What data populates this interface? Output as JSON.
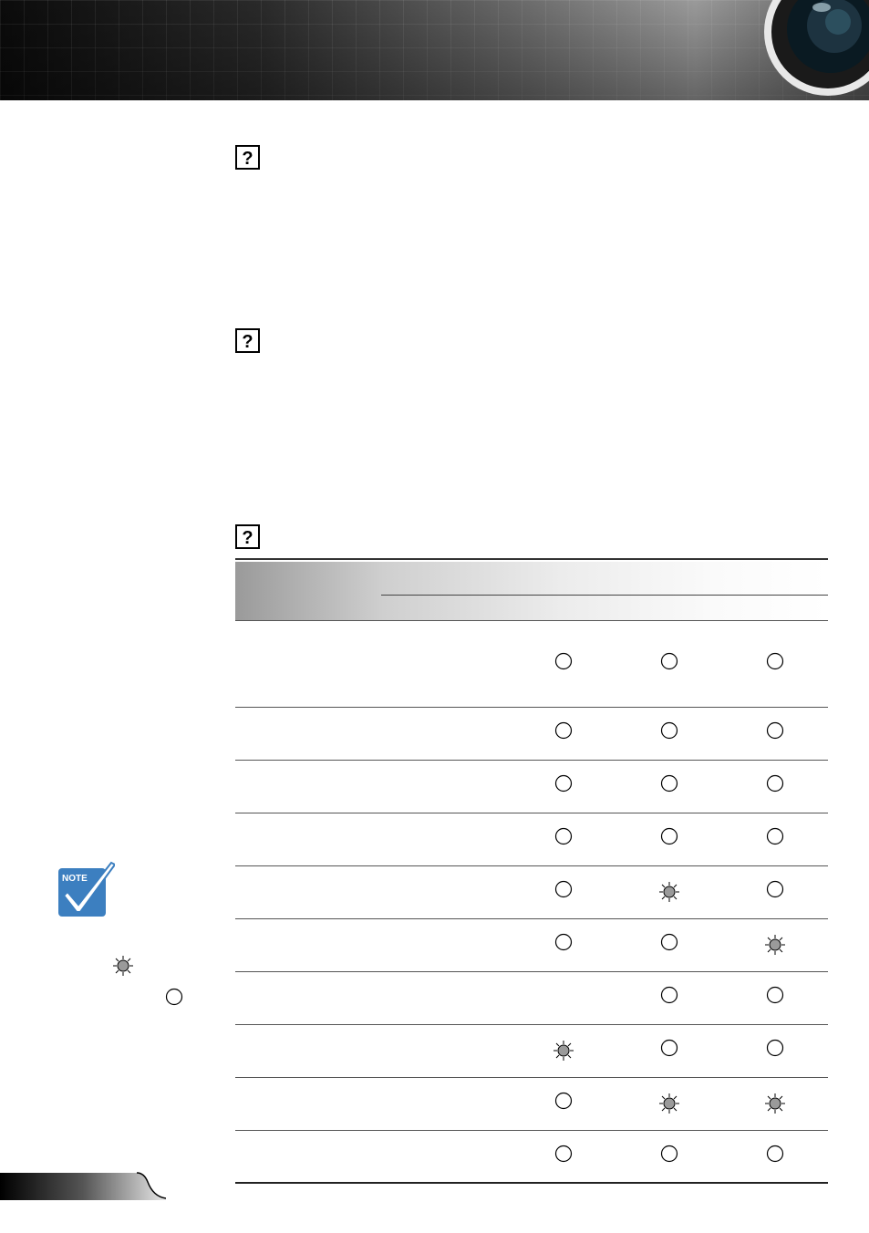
{
  "header": {
    "decoration": "projector-lens-banner"
  },
  "sections": [
    {
      "icon": "question-mark-icon"
    },
    {
      "icon": "question-mark-icon"
    },
    {
      "icon": "question-mark-icon"
    }
  ],
  "indicator_table": {
    "columns": 3,
    "rows": [
      [
        "off",
        "off",
        "off"
      ],
      [
        "off",
        "off",
        "off"
      ],
      [
        "off",
        "off",
        "off"
      ],
      [
        "off",
        "off",
        "off"
      ],
      [
        "off",
        "flashing",
        "off"
      ],
      [
        "off",
        "off",
        "flashing"
      ],
      [
        null,
        "off",
        "off"
      ],
      [
        "flashing",
        "off",
        "off"
      ],
      [
        "off",
        "flashing",
        "flashing"
      ],
      [
        "off",
        "off",
        "off"
      ]
    ]
  },
  "sidebar_note": {
    "badge": "NOTE",
    "legend": [
      {
        "icon": "flashing-led-icon"
      },
      {
        "icon": "off-led-icon"
      }
    ]
  },
  "colors": {
    "note_blue": "#3c7fc0",
    "led_fill": "#9a9a9a",
    "rule": "#333333"
  }
}
